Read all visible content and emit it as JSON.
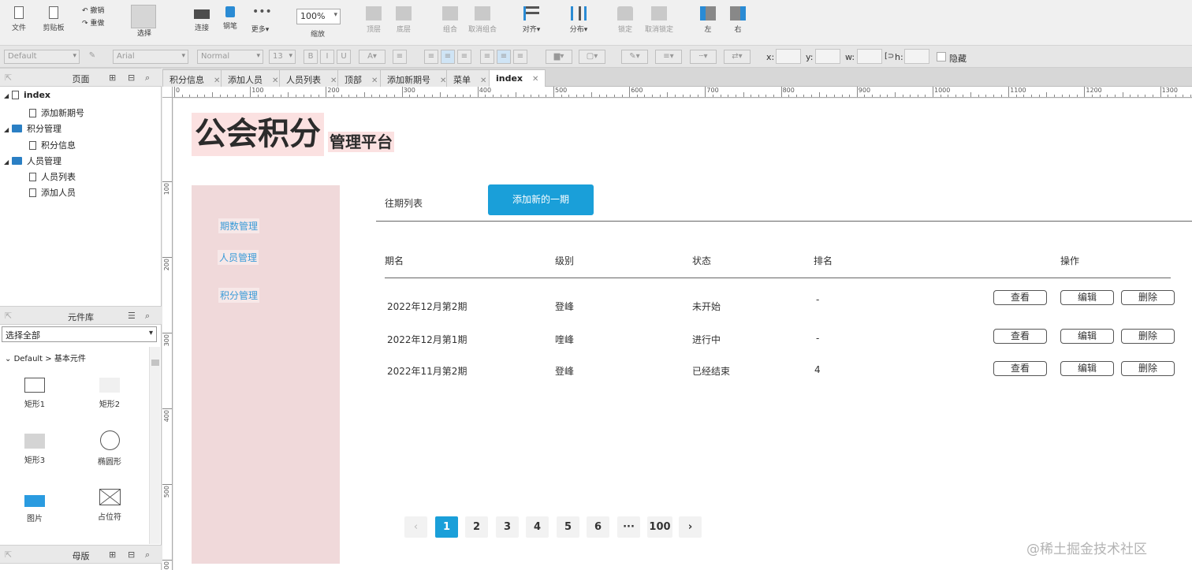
{
  "toolbar": {
    "file": "文件",
    "clipboard": "剪贴板",
    "undo": "撤销",
    "redo": "重做",
    "select": "选择",
    "connect": "连接",
    "pen": "钢笔",
    "more": "更多▾",
    "zoom_value": "100%",
    "zoom_label": "缩放",
    "top": "顶层",
    "bottom": "底层",
    "group": "组合",
    "ungroup": "取消组合",
    "align": "对齐▾",
    "distribute": "分布▾",
    "lock": "锁定",
    "unlock": "取消锁定",
    "left": "左",
    "right": "右"
  },
  "formatbar": {
    "style": "Default",
    "font": "Arial",
    "weight": "Normal",
    "size": "13",
    "x_label": "x:",
    "y_label": "y:",
    "w_label": "w:",
    "h_label": "h:",
    "hide_label": "隐藏"
  },
  "pages_panel": {
    "title": "页面",
    "items": [
      {
        "label": "index",
        "level": 0,
        "kind": "page"
      },
      {
        "label": "添加新期号",
        "level": 1,
        "kind": "page"
      },
      {
        "label": "积分管理",
        "level": 0,
        "kind": "folder"
      },
      {
        "label": "积分信息",
        "level": 1,
        "kind": "page"
      },
      {
        "label": "人员管理",
        "level": 0,
        "kind": "folder"
      },
      {
        "label": "人员列表",
        "level": 1,
        "kind": "page"
      },
      {
        "label": "添加人员",
        "level": 1,
        "kind": "page"
      }
    ]
  },
  "library_panel": {
    "title": "元件库",
    "select_value": "选择全部",
    "group": "Default > 基本元件",
    "widgets": [
      {
        "label": "矩形1"
      },
      {
        "label": "矩形2"
      },
      {
        "label": "矩形3"
      },
      {
        "label": "椭圆形"
      },
      {
        "label": "图片"
      },
      {
        "label": "占位符"
      }
    ]
  },
  "masters_panel": {
    "title": "母版"
  },
  "tabs": [
    {
      "label": "积分信息",
      "active": false
    },
    {
      "label": "添加人员",
      "active": false
    },
    {
      "label": "人员列表",
      "active": false
    },
    {
      "label": "顶部",
      "active": false
    },
    {
      "label": "添加新期号",
      "active": false
    },
    {
      "label": "菜单",
      "active": false
    },
    {
      "label": "index",
      "active": true
    }
  ],
  "ruler": {
    "h": [
      "0",
      "100",
      "200",
      "300",
      "400",
      "500",
      "600",
      "700",
      "800",
      "900",
      "1000",
      "1100",
      "1200",
      "1300"
    ],
    "v": [
      "100",
      "200",
      "300",
      "400",
      "500",
      "500"
    ]
  },
  "page": {
    "logo": "公会积分",
    "logo_sub": "管理平台",
    "menu": [
      "期数管理",
      "人员管理",
      "积分管理"
    ],
    "section_title": "往期列表",
    "add_button": "添加新的一期",
    "table": {
      "headers": [
        "期名",
        "级别",
        "状态",
        "排名",
        "操作"
      ],
      "rows": [
        [
          "2022年12月第2期",
          "登峰",
          "未开始",
          "-"
        ],
        [
          "2022年12月第1期",
          "喹峰",
          "进行中",
          "-"
        ],
        [
          "2022年11月第2期",
          "登峰",
          "已经结束",
          "4"
        ]
      ],
      "actions": [
        "查看",
        "编辑",
        "删除"
      ]
    },
    "pagination": [
      "‹",
      "1",
      "2",
      "3",
      "4",
      "5",
      "6",
      "···",
      "100",
      "›"
    ],
    "current_page": "1"
  },
  "watermark": "@稀土掘金技术社区",
  "colors": {
    "accent": "#1a9fd9",
    "sidebar": "#f0d9da",
    "logo_bg": "#fbe1e1"
  }
}
